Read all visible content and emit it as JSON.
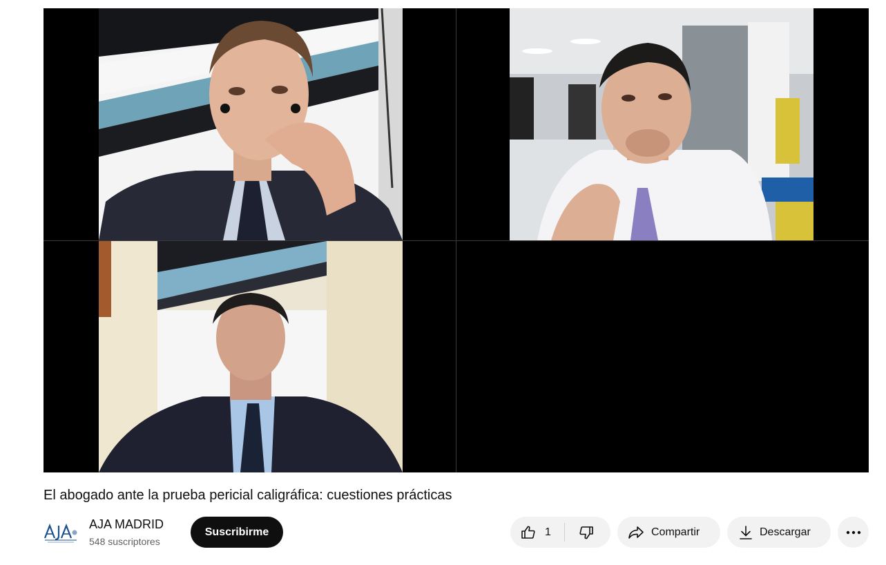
{
  "video": {
    "title": "El abogado ante la prueba pericial caligráfica: cuestiones prácticas"
  },
  "channel": {
    "name": "AJA MADRID",
    "subscribers": "548 suscriptores",
    "logo_icon": "aja-logo-icon"
  },
  "actions": {
    "subscribe_label": "Suscribirme",
    "like_count": "1",
    "share_label": "Compartir",
    "download_label": "Descargar",
    "more_icon": "more-horizontal-icon"
  },
  "colors": {
    "subscribe_bg": "#0f0f0f",
    "pill_bg": "#f2f2f2",
    "subtext": "#606060"
  }
}
